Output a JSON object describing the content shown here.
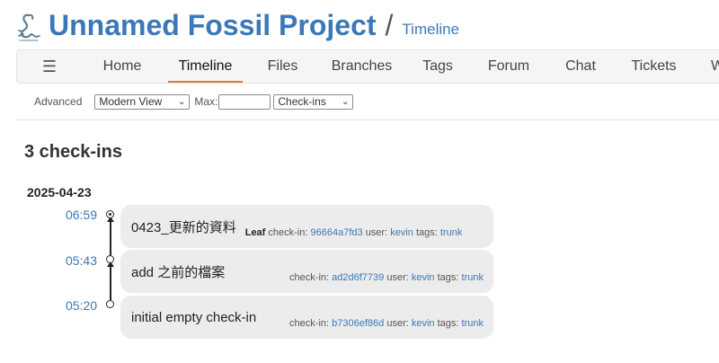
{
  "header": {
    "project_title": "Unnamed Fossil Project",
    "separator": "/",
    "page_title": "Timeline"
  },
  "menu": {
    "hamburger": "☰",
    "items": [
      "Home",
      "Timeline",
      "Files",
      "Branches",
      "Tags",
      "Forum",
      "Chat",
      "Tickets",
      "Wiki"
    ],
    "active": "Timeline"
  },
  "submenu": {
    "advanced": "Advanced",
    "view_select": "Modern View",
    "max_label": "Max:",
    "max_value": "",
    "type_select": "Check-ins"
  },
  "timeline": {
    "heading": "3 check-ins",
    "date": "2025-04-23",
    "entries": [
      {
        "time": "06:59",
        "comment": "0423_更新的資料",
        "leaf": "Leaf",
        "checkin_label": "check-in:",
        "hash": "96664a7fd3",
        "user_label": "user:",
        "user": "kevin",
        "tags_label": "tags:",
        "tag": "trunk"
      },
      {
        "time": "05:43",
        "comment": "add 之前的檔案",
        "leaf": "",
        "checkin_label": "check-in:",
        "hash": "ad2d6f7739",
        "user_label": "user:",
        "user": "kevin",
        "tags_label": "tags:",
        "tag": "trunk"
      },
      {
        "time": "05:20",
        "comment": "initial empty check-in",
        "leaf": "",
        "checkin_label": "check-in:",
        "hash": "b7306ef86d",
        "user_label": "user:",
        "user": "kevin",
        "tags_label": "tags:",
        "tag": "trunk"
      }
    ]
  },
  "colors": {
    "link": "#3b78b7",
    "active_tab_underline": "#e07a2e",
    "bubble": "#ececec"
  },
  "icons": {
    "logo": "fossil-logo-icon",
    "menu": "hamburger-menu-icon",
    "dropdown": "chevron-down-icon"
  }
}
